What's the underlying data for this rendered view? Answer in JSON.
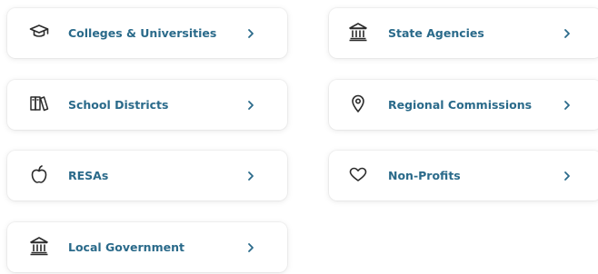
{
  "links": {
    "colleges": {
      "label": "Colleges & Universities",
      "icon": "graduation-cap-icon"
    },
    "state_agencies": {
      "label": "State Agencies",
      "icon": "government-building-icon"
    },
    "school_districts": {
      "label": "School Districts",
      "icon": "books-icon"
    },
    "regional_commissions": {
      "label": "Regional Commissions",
      "icon": "map-pin-icon"
    },
    "resas": {
      "label": "RESAs",
      "icon": "apple-icon"
    },
    "non_profits": {
      "label": "Non-Profits",
      "icon": "heart-icon"
    },
    "local_government": {
      "label": "Local Government",
      "icon": "government-building-icon"
    }
  },
  "colors": {
    "text": "#2a6a8a",
    "icon": "#2b2b2b",
    "chevron": "#2a6a8a"
  }
}
